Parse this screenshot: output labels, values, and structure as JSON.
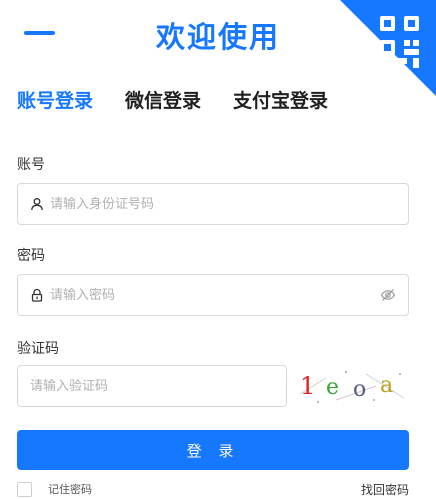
{
  "header": {
    "title": "欢迎使用"
  },
  "qr_toggle": {
    "icon": "qr-code-icon",
    "color": "#1677ff"
  },
  "tabs": [
    {
      "label": "账号登录",
      "active": true
    },
    {
      "label": "微信登录",
      "active": false
    },
    {
      "label": "支付宝登录",
      "active": false
    }
  ],
  "form": {
    "account": {
      "label": "账号",
      "placeholder": "请输入身份证号码",
      "icon": "user-icon"
    },
    "password": {
      "label": "密码",
      "placeholder": "请输入密码",
      "icon": "lock-icon",
      "toggle_icon": "eye-off-icon"
    },
    "captcha": {
      "label": "验证码",
      "placeholder": "请输入验证码",
      "code": [
        "1",
        "e",
        "o",
        "a"
      ]
    }
  },
  "actions": {
    "login_label": "登 录",
    "remember_label": "记住密码",
    "forgot_label": "找回密码"
  },
  "colors": {
    "primary": "#1677ff",
    "border": "#d9d9d9",
    "placeholder": "#b0b0b0"
  }
}
